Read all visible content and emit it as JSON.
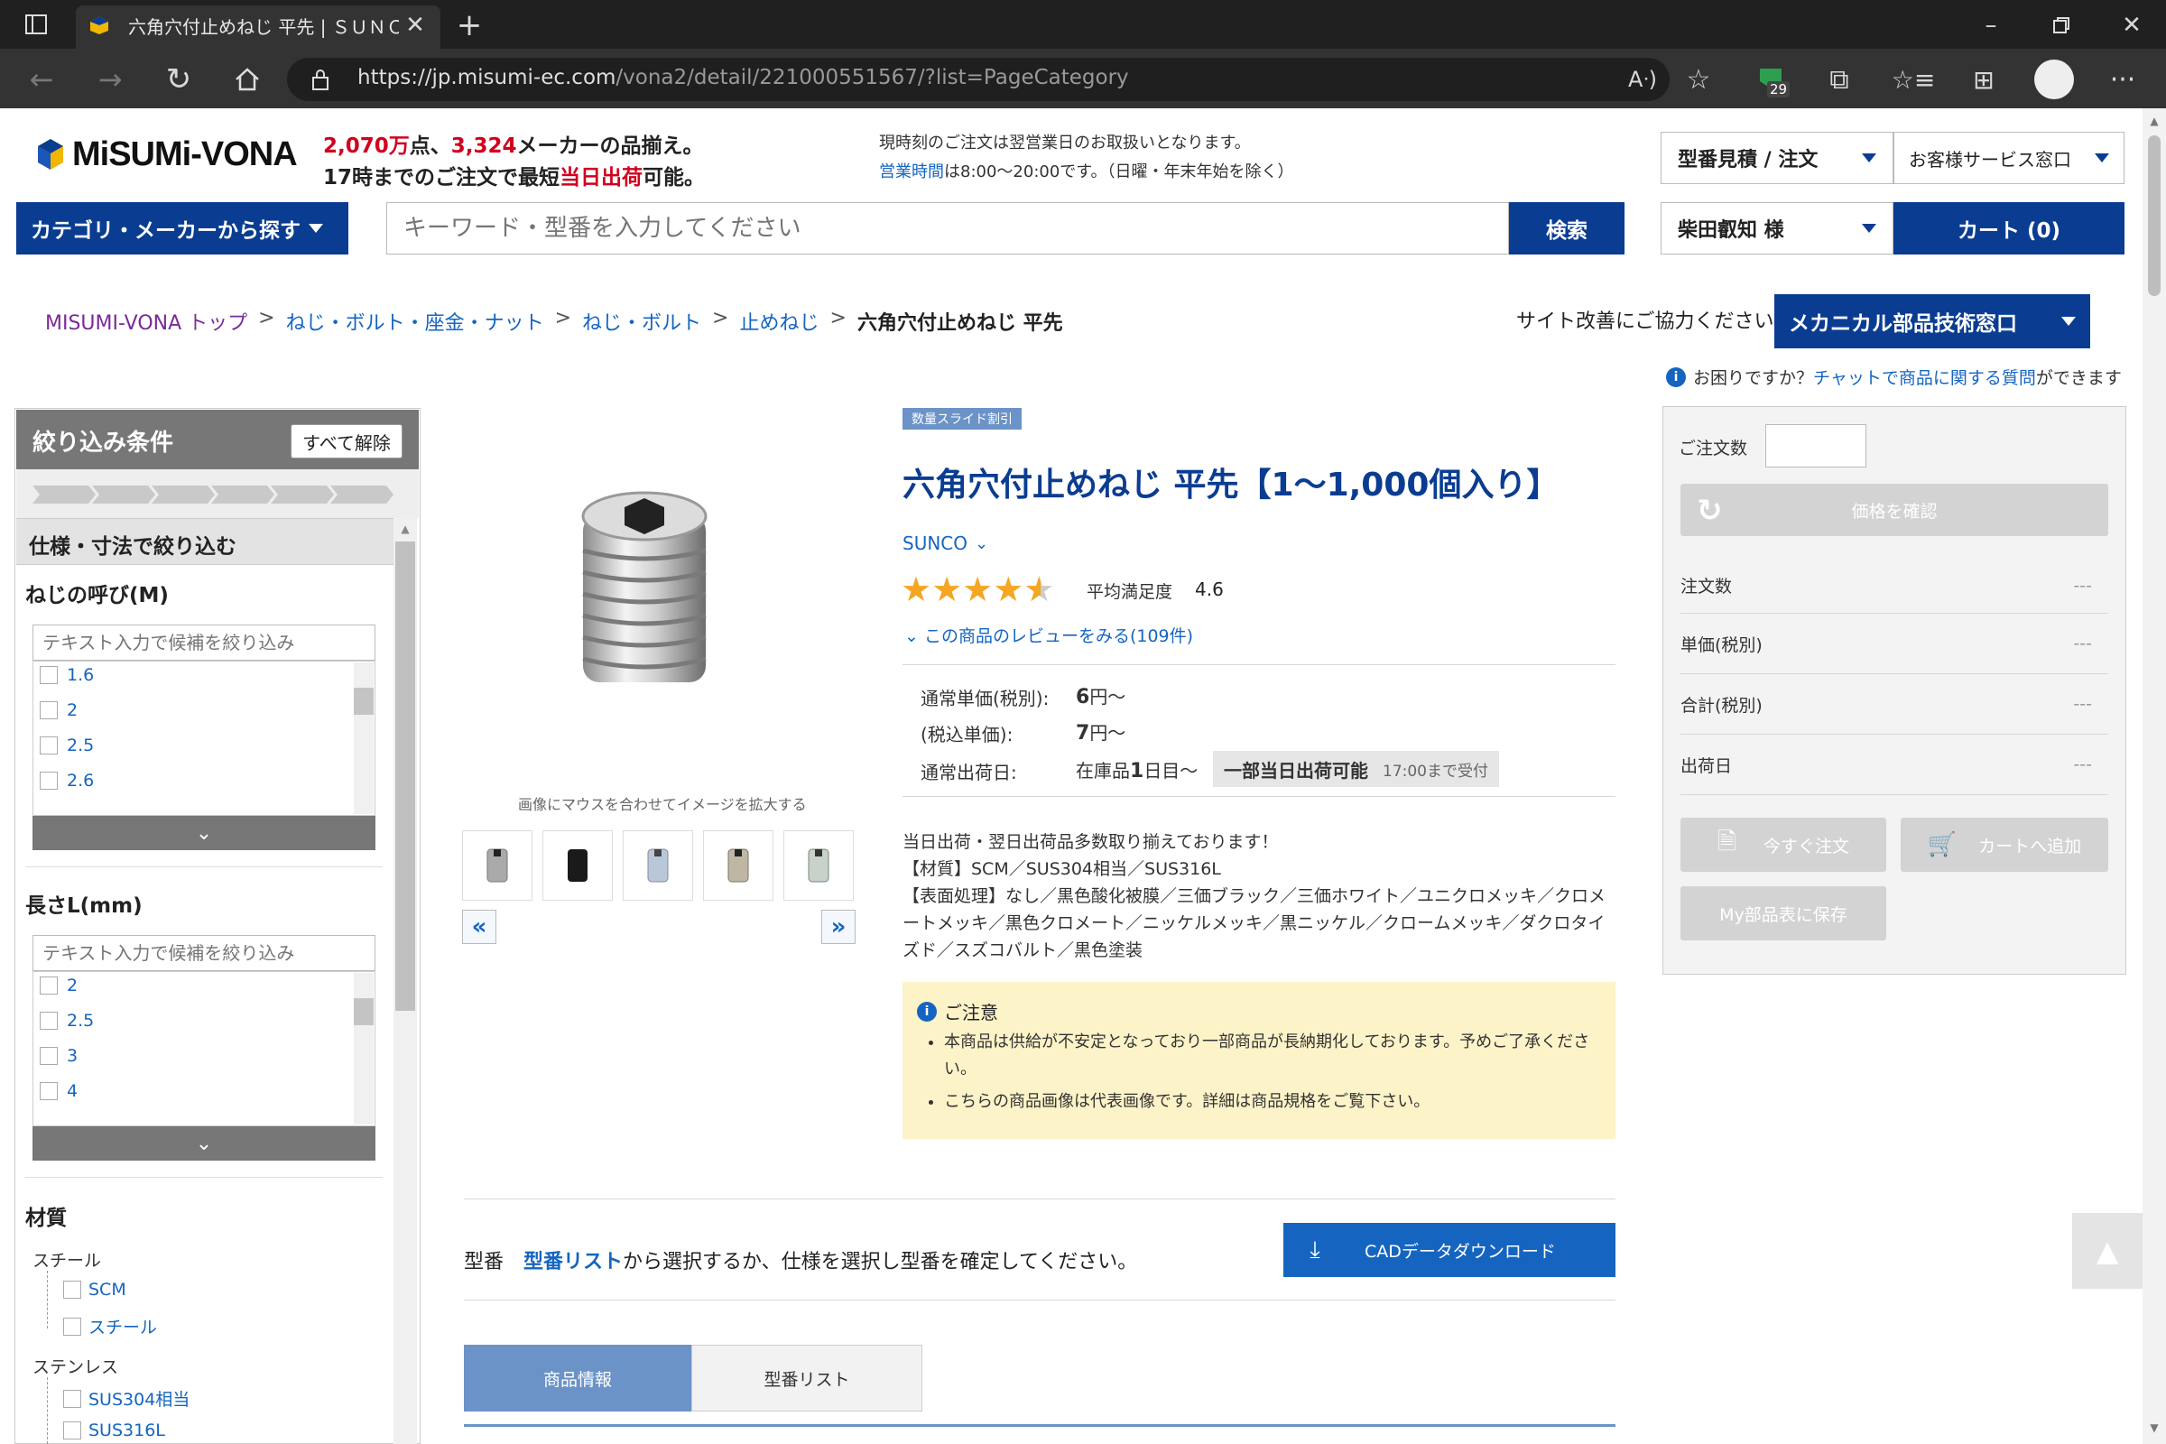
{
  "browser": {
    "tab_title": "六角穴付止めねじ 平先 | ＳＵＮＣ",
    "url_host": "https://jp.misumi-ec.com",
    "url_path": "/vona2/detail/221000551567/?list=PageCategory",
    "ext_badge": "29"
  },
  "header": {
    "logo": "MiSUMi-VONA",
    "promo_line1": {
      "a": "2,070万",
      "b": "点、",
      "c": "3,324",
      "d": "メーカーの品揃え。"
    },
    "promo_line2": {
      "a": "17時までのご注文で最短",
      "b": "当日出荷",
      "c": "可能。"
    },
    "notice1": "現時刻のご注文は翌営業日のお取扱いとなります。",
    "notice2_link": "営業時間",
    "notice2_rest": "は8:00〜20:00です。（日曜・年末年始を除く）",
    "quote_order": "型番見積 / 注文",
    "customer_service": "お客様サービス窓口",
    "category_btn": "カテゴリ・メーカーから探す",
    "search_placeholder": "キーワード・型番を入力してください",
    "search_btn": "検索",
    "user": "柴田叡知 様",
    "cart": "カート (0)"
  },
  "breadcrumb": [
    "MISUMI-VONA トップ",
    "ねじ・ボルト・座金・ナット",
    "ねじ・ボルト",
    "止めねじ",
    "六角穴付止めねじ 平先"
  ],
  "feedback": "サイト改善にご協力ください",
  "tech_window": "メカニカル部品技術窓口",
  "help": {
    "pre": "お困りですか？",
    "link": "チャットで商品に関する質問",
    "post": "ができます"
  },
  "filter": {
    "title": "絞り込み条件",
    "clear": "すべて解除",
    "spec_title": "仕様・寸法で絞り込む",
    "thread": {
      "label": "ねじの呼び(M)",
      "placeholder": "テキスト入力で候補を絞り込み",
      "options": [
        "1.6",
        "2",
        "2.5",
        "2.6"
      ]
    },
    "length": {
      "label": "長さL(mm)",
      "placeholder": "テキスト入力で候補を絞り込み",
      "options": [
        "2",
        "2.5",
        "3",
        "4"
      ]
    },
    "material": {
      "label": "材質",
      "groups": [
        {
          "name": "スチール",
          "items": [
            "SCM",
            "スチール"
          ]
        },
        {
          "name": "ステンレス",
          "items": [
            "SUS304相当",
            "SUS316L"
          ]
        }
      ]
    }
  },
  "product": {
    "badge": "数量スライド割引",
    "title": "六角穴付止めねじ 平先【1〜1,000個入り】",
    "brand": "SUNCO",
    "rating_label": "平均満足度",
    "rating": "4.6",
    "rating_value": 4.6,
    "reviews": "この商品のレビューをみる(109件)",
    "zoom_hint": "画像にマウスを合わせてイメージを拡大する",
    "price_label": "通常単価(税別):",
    "price_num": "6",
    "price_unit": "円〜",
    "tax_label": "(税込単価):",
    "tax_num": "7",
    "tax_unit": "円〜",
    "ship_label": "通常出荷日:",
    "ship_val_pre": "在庫品",
    "ship_val_num": "1",
    "ship_val_post": "日目〜",
    "same_day": "一部当日出荷可能",
    "same_day_note": "17:00まで受付",
    "desc1": "当日出荷・翌日出荷品多数取り揃えております！",
    "desc2": "【材質】SCM／SUS304相当／SUS316L",
    "desc3": "【表面処理】なし／黒色酸化被膜／三価ブラック／三価ホワイト／ユニクロメッキ／クロメートメッキ／黒色クロメート／ニッケルメッキ／黒ニッケル／クロームメッキ／ダクロタイズド／スズコバルト／黒色塗装",
    "caution_title": "ご注意",
    "caution1": "本商品は供給が不安定となっており一部商品が長納期化しております。予めご了承ください。",
    "caution2": "こちらの商品画像は代表画像です。詳細は商品規格をご覧下さい。"
  },
  "order_panel": {
    "qty_label": "ご注文数",
    "check_price": "価格を確認",
    "rows": [
      {
        "k": "注文数",
        "v": "---"
      },
      {
        "k": "単価(税別)",
        "v": "---"
      },
      {
        "k": "合計(税別)",
        "v": "---"
      },
      {
        "k": "出荷日",
        "v": "---"
      }
    ],
    "order_now": "今すぐ注文",
    "add_cart": "カートへ追加",
    "save_list": "My部品表に保存"
  },
  "model": {
    "label": "型番",
    "link": "型番リスト",
    "text": "から選択するか、仕様を選択し型番を確定してください。",
    "cad": "CADデータダウンロード"
  },
  "tabs": [
    "商品情報",
    "型番リスト"
  ],
  "colors": {
    "navy": "#0a3d91",
    "link": "#1565c0",
    "caution_bg": "#fdf3c8",
    "tab_active": "#6b93c8"
  }
}
